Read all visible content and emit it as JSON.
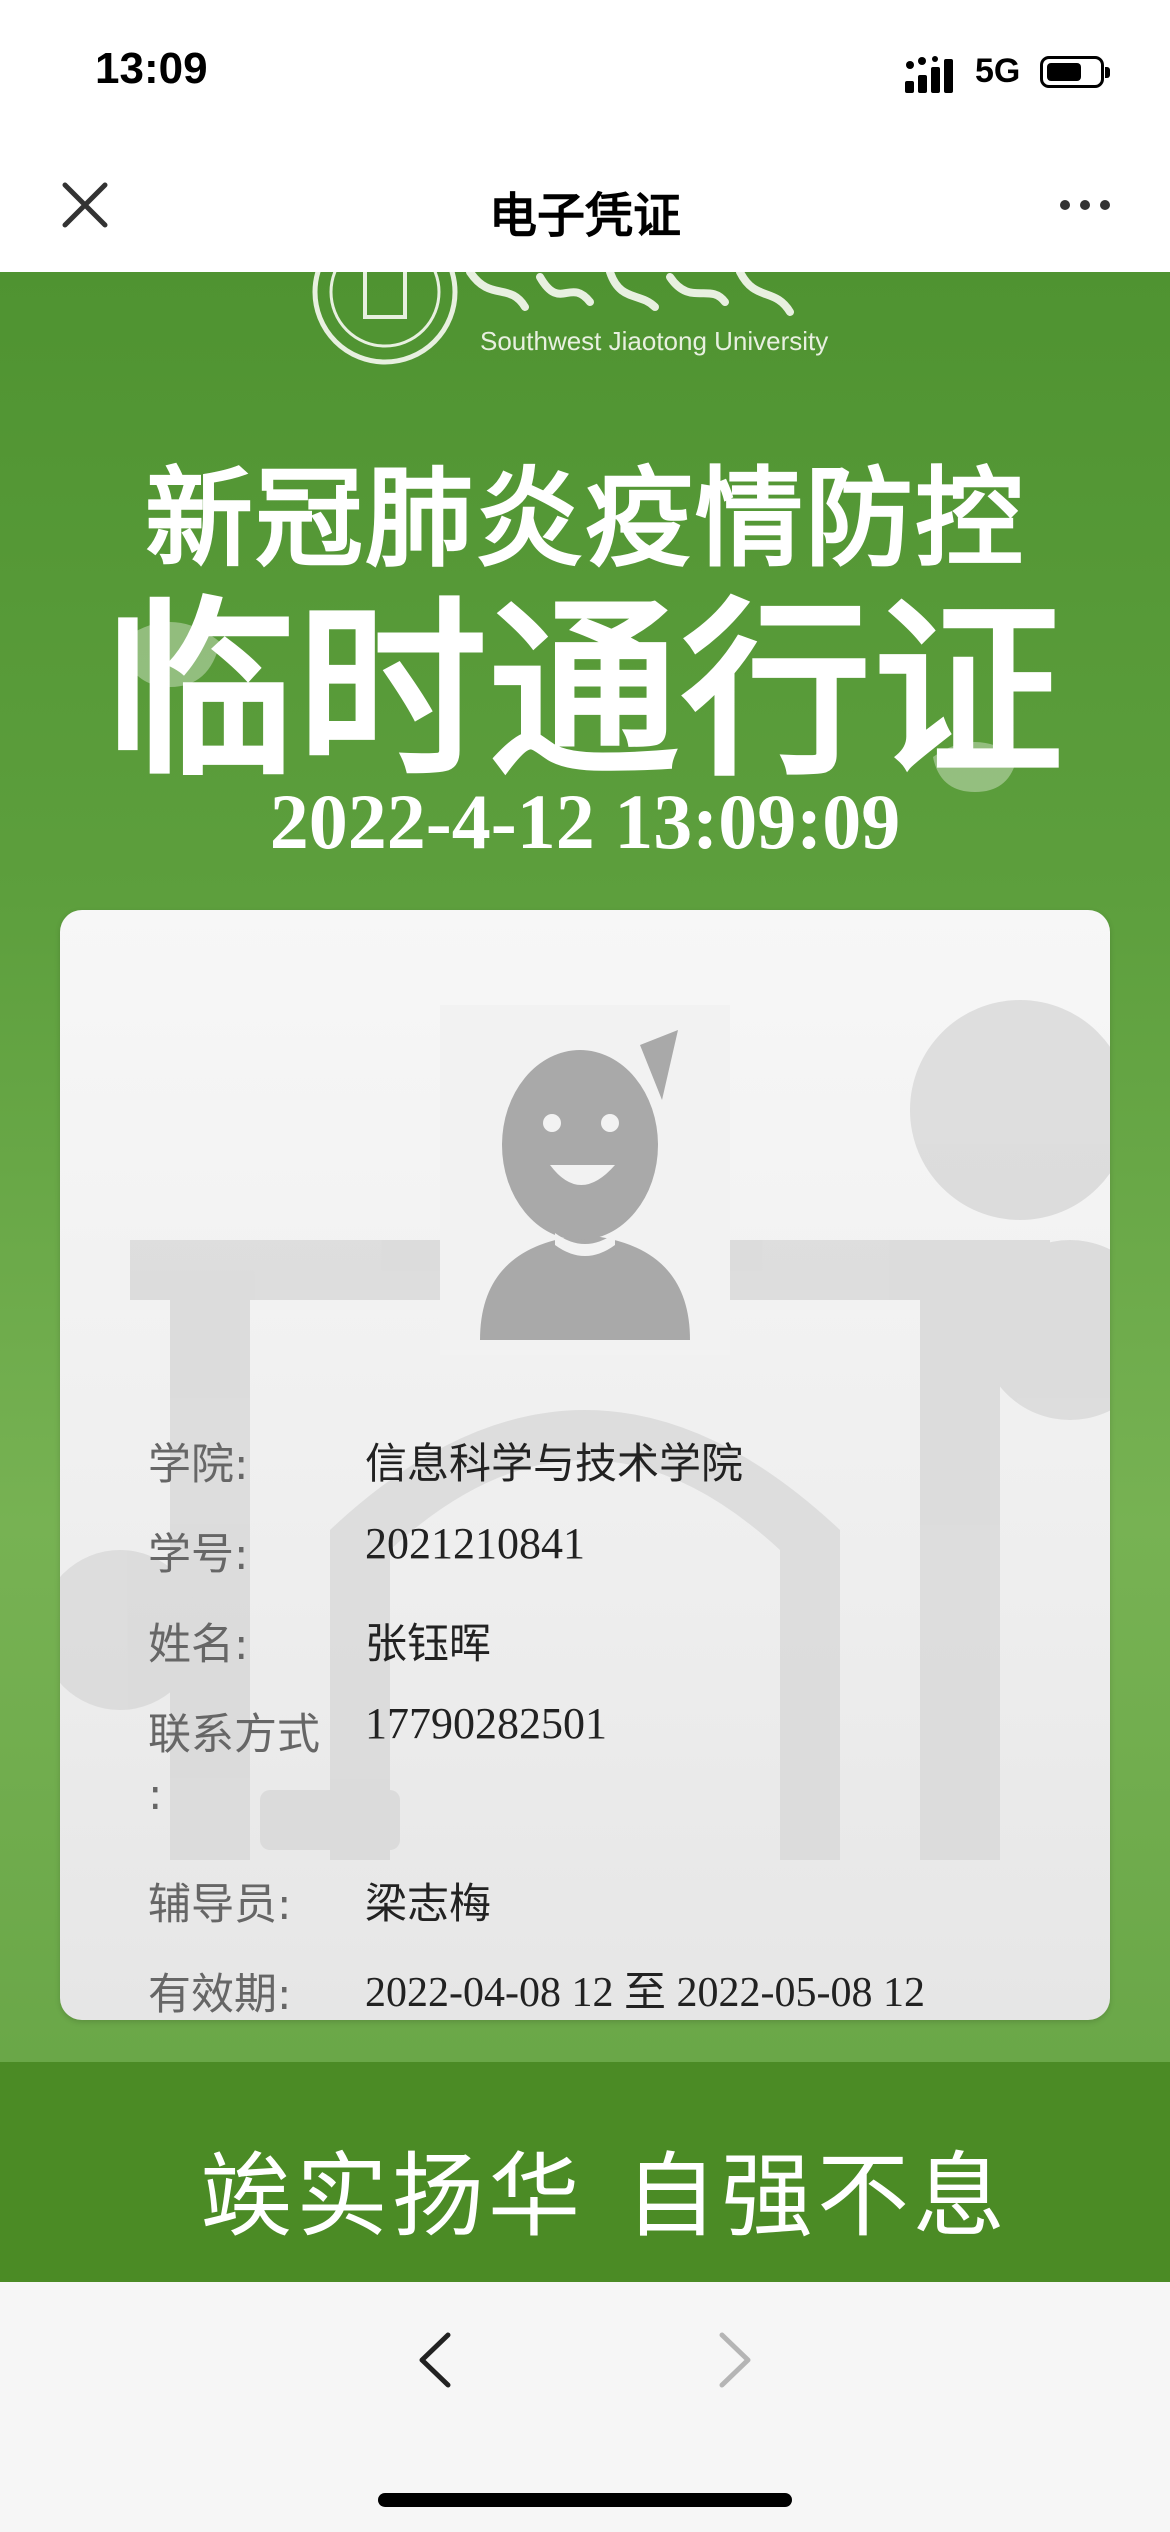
{
  "status": {
    "time": "13:09",
    "network": "5G"
  },
  "nav": {
    "title": "电子凭证"
  },
  "header": {
    "university_en": "Southwest Jiaotong University",
    "title_line1": "新冠肺炎疫情防控",
    "title_line2": "临时通行证",
    "timestamp": "2022-4-12 13:09:09"
  },
  "card": {
    "fields": [
      {
        "label": "学院:",
        "value": "信息科学与技术学院"
      },
      {
        "label": "学号:",
        "value": "2021210841"
      },
      {
        "label": "姓名:",
        "value": "张钰晖"
      },
      {
        "label": "联系方式",
        "value": "17790282501"
      },
      {
        "label": ":",
        "value": ""
      },
      {
        "label": "辅导员:",
        "value": "梁志梅"
      },
      {
        "label": "有效期:",
        "value": "2022-04-08 12 至 2022-05-08 12"
      }
    ]
  },
  "motto": {
    "left": "竢实扬华",
    "right": "自强不息"
  },
  "colors": {
    "hero_green": "#5d9f3d",
    "band_green": "#4b8b25"
  }
}
